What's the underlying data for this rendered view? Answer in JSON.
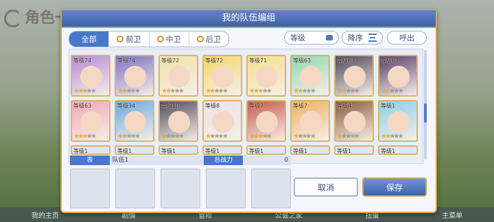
{
  "background": {
    "title": "角色一览",
    "nav": [
      "我的主页",
      "剧情",
      "冒险",
      "公会之家",
      "扭蛋",
      "主菜单"
    ]
  },
  "dialog": {
    "title": "我的队伍编组"
  },
  "filters": {
    "tabs": [
      "全部",
      "前卫",
      "中卫",
      "后卫"
    ],
    "active_tab": "全部",
    "level_label": "等级",
    "sort_label": "降序",
    "callout_label": "呼出"
  },
  "characters": [
    {
      "level": "等级74",
      "stars": 3,
      "color": "#b58ad6"
    },
    {
      "level": "等级74",
      "stars": 2,
      "color": "#7a6fc4"
    },
    {
      "level": "等级72",
      "stars": 2,
      "color": "#f1e3a8"
    },
    {
      "level": "等级72",
      "stars": 2,
      "color": "#f5d86a"
    },
    {
      "level": "等级71",
      "stars": 3,
      "color": "#f3e08a"
    },
    {
      "level": "等级63",
      "stars": 2,
      "color": "#8fd8b0"
    },
    {
      "level": "等级63",
      "stars": 2,
      "color": "#4a4658"
    },
    {
      "level": "等级63",
      "stars": 2,
      "color": "#5a3a6a"
    },
    {
      "level": "等级63",
      "stars": 3,
      "color": "#f2a6b8"
    },
    {
      "level": "等级34",
      "stars": 2,
      "color": "#6aa8e0"
    },
    {
      "level": "等级10",
      "stars": 1,
      "color": "#4e4a5a"
    },
    {
      "level": "等级8",
      "stars": 1,
      "color": "#e8e4ea"
    },
    {
      "level": "等级7",
      "stars": 3,
      "color": "#c8584a"
    },
    {
      "level": "等级7",
      "stars": 1,
      "color": "#f0b060"
    },
    {
      "level": "等级4",
      "stars": 1,
      "color": "#8a5a3a"
    },
    {
      "level": "等级1",
      "stars": 2,
      "color": "#8ad0e8"
    }
  ],
  "partial_levels": [
    "等级1",
    "等级1",
    "等级1",
    "等级1",
    "等级1",
    "等级1",
    "等级1",
    "等级1"
  ],
  "team": {
    "tag": "表",
    "name": "队伍1",
    "power_label": "总战力",
    "power_value": "0"
  },
  "buttons": {
    "cancel": "取消",
    "save": "保存"
  }
}
